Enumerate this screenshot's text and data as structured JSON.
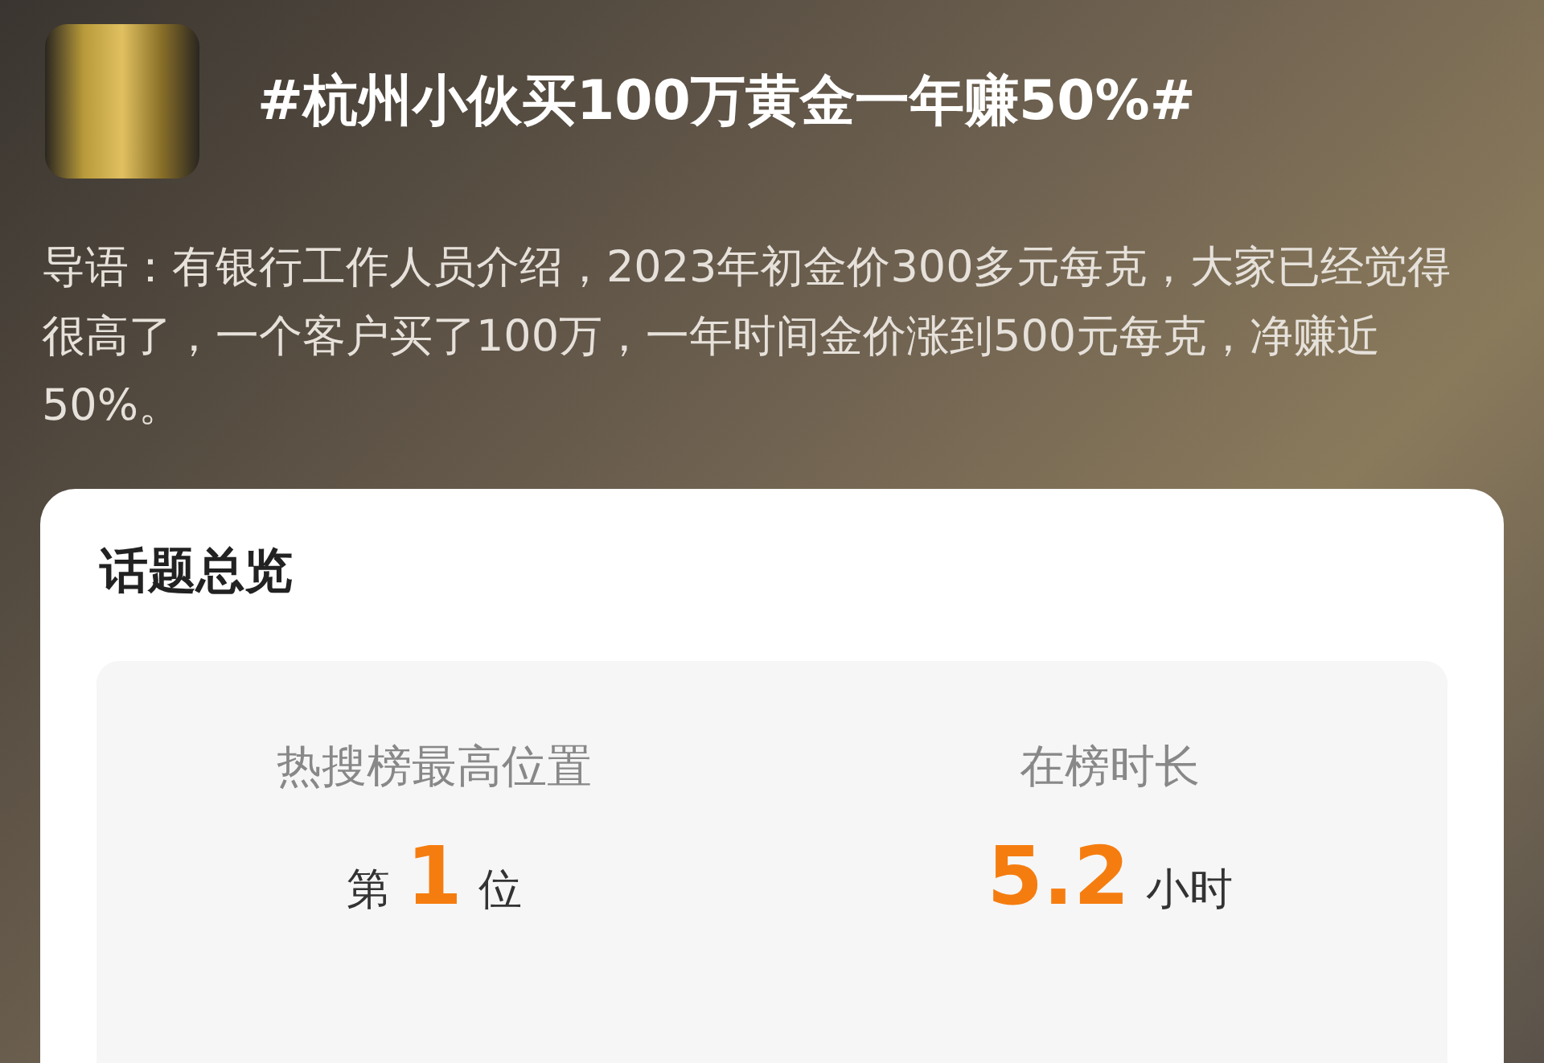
{
  "topic": {
    "title": "#杭州小伙买100万黄金一年赚50%#",
    "intro": "导语：有银行工作人员介绍，2023年初金价300多元每克，大家已经觉得很高了，一个客户买了100万，一年时间金价涨到500元每克，净赚近50%。"
  },
  "overview": {
    "title": "话题总览",
    "stats": [
      {
        "label": "热搜榜最高位置",
        "prefix": "第",
        "value": "1",
        "unit": "位"
      },
      {
        "label": "在榜时长",
        "value": "5.2",
        "unit": "小时"
      }
    ]
  }
}
